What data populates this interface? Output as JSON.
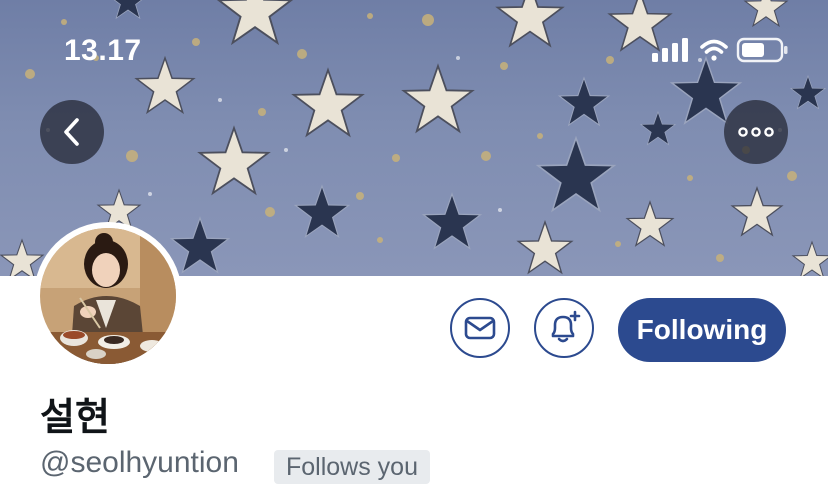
{
  "status_bar": {
    "time": "13.17",
    "icons": [
      "cellular-signal-icon",
      "wifi-icon",
      "battery-icon"
    ]
  },
  "header": {
    "back_icon": "chevron-left-icon",
    "more_icon": "ellipsis-icon"
  },
  "profile": {
    "avatar": "profile-photo",
    "display_name": "설현",
    "handle": "@seolhyuntion",
    "follows_you_label": "Follows you"
  },
  "actions": {
    "message_icon": "envelope-icon",
    "notification_icon": "bell-plus-icon",
    "follow_label": "Following"
  },
  "colors": {
    "accent": "#2c4a8f",
    "banner": "#7f8db1",
    "handle_text": "#5b6570",
    "badge_bg": "#e8ebee"
  }
}
